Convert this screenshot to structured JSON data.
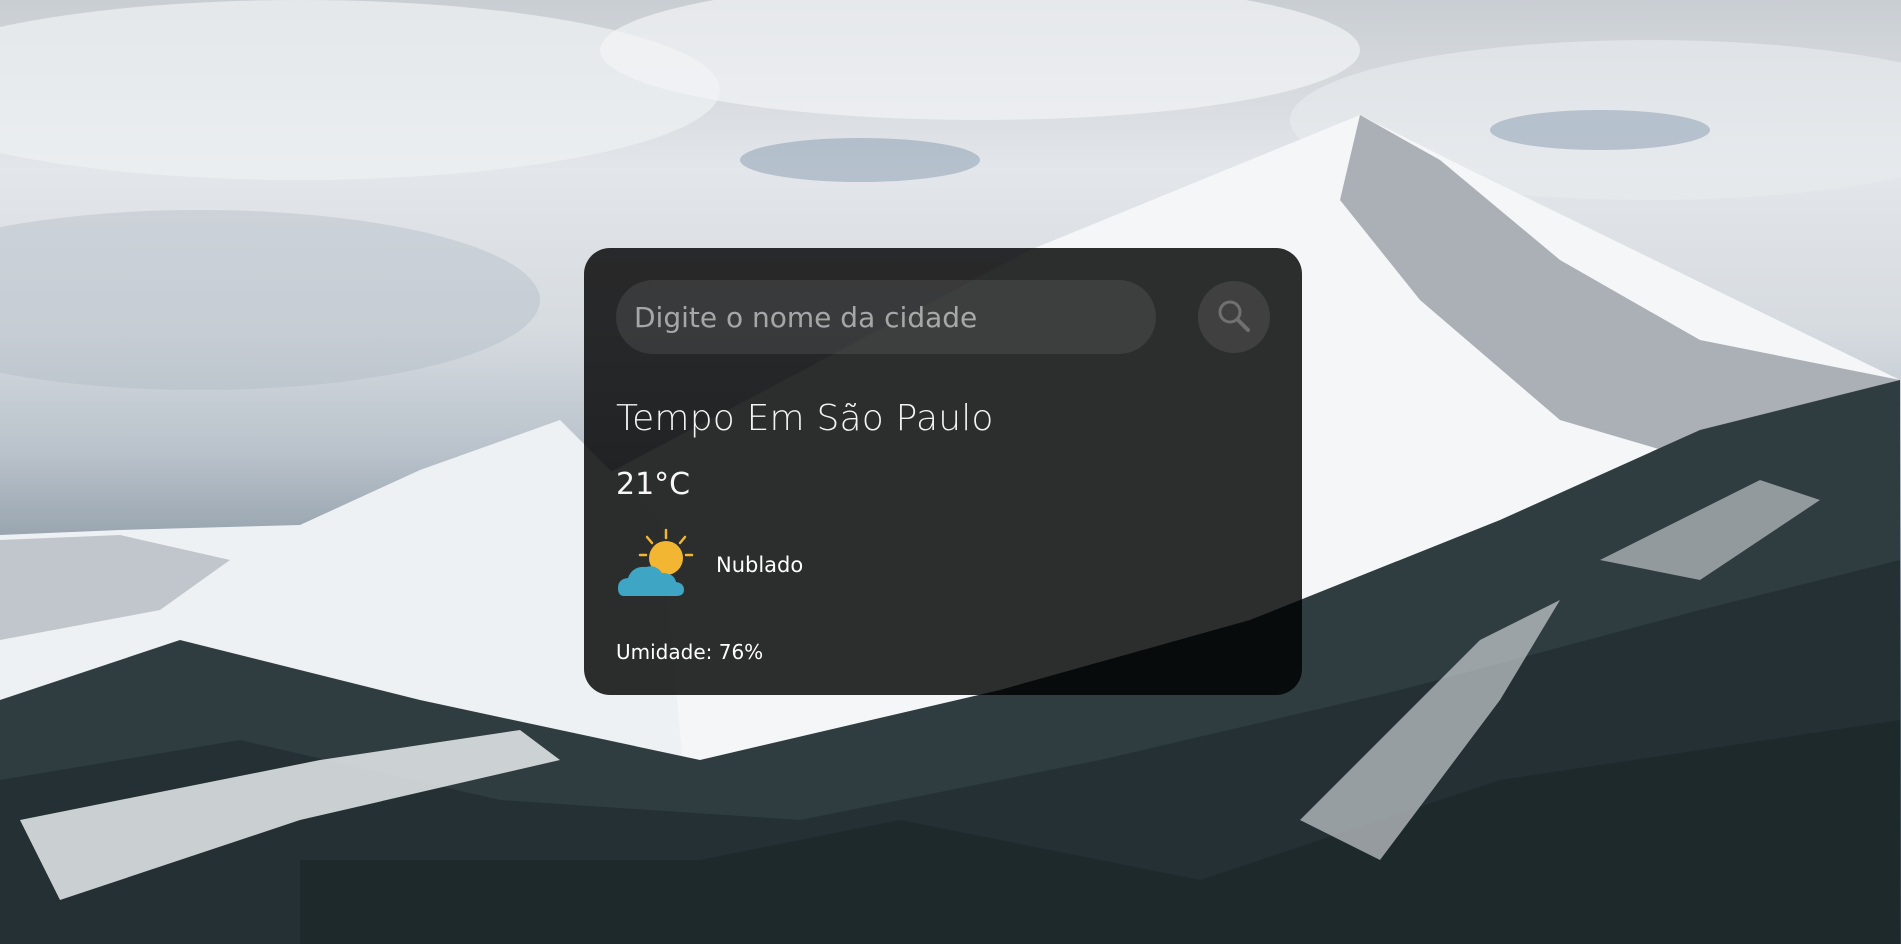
{
  "search": {
    "placeholder": "Digite o nome da cidade",
    "icon": "search-icon"
  },
  "weather": {
    "title": "Tempo Em São Paulo",
    "temperature": "21°C",
    "icon": "partly-cloudy-icon",
    "description": "Nublado",
    "humidity": "Umidade: 76%"
  },
  "colors": {
    "card_background": "rgba(0,0,0,0.82)",
    "text": "#ffffff",
    "sun": "#f2b632",
    "cloud": "#3ea6c4"
  }
}
